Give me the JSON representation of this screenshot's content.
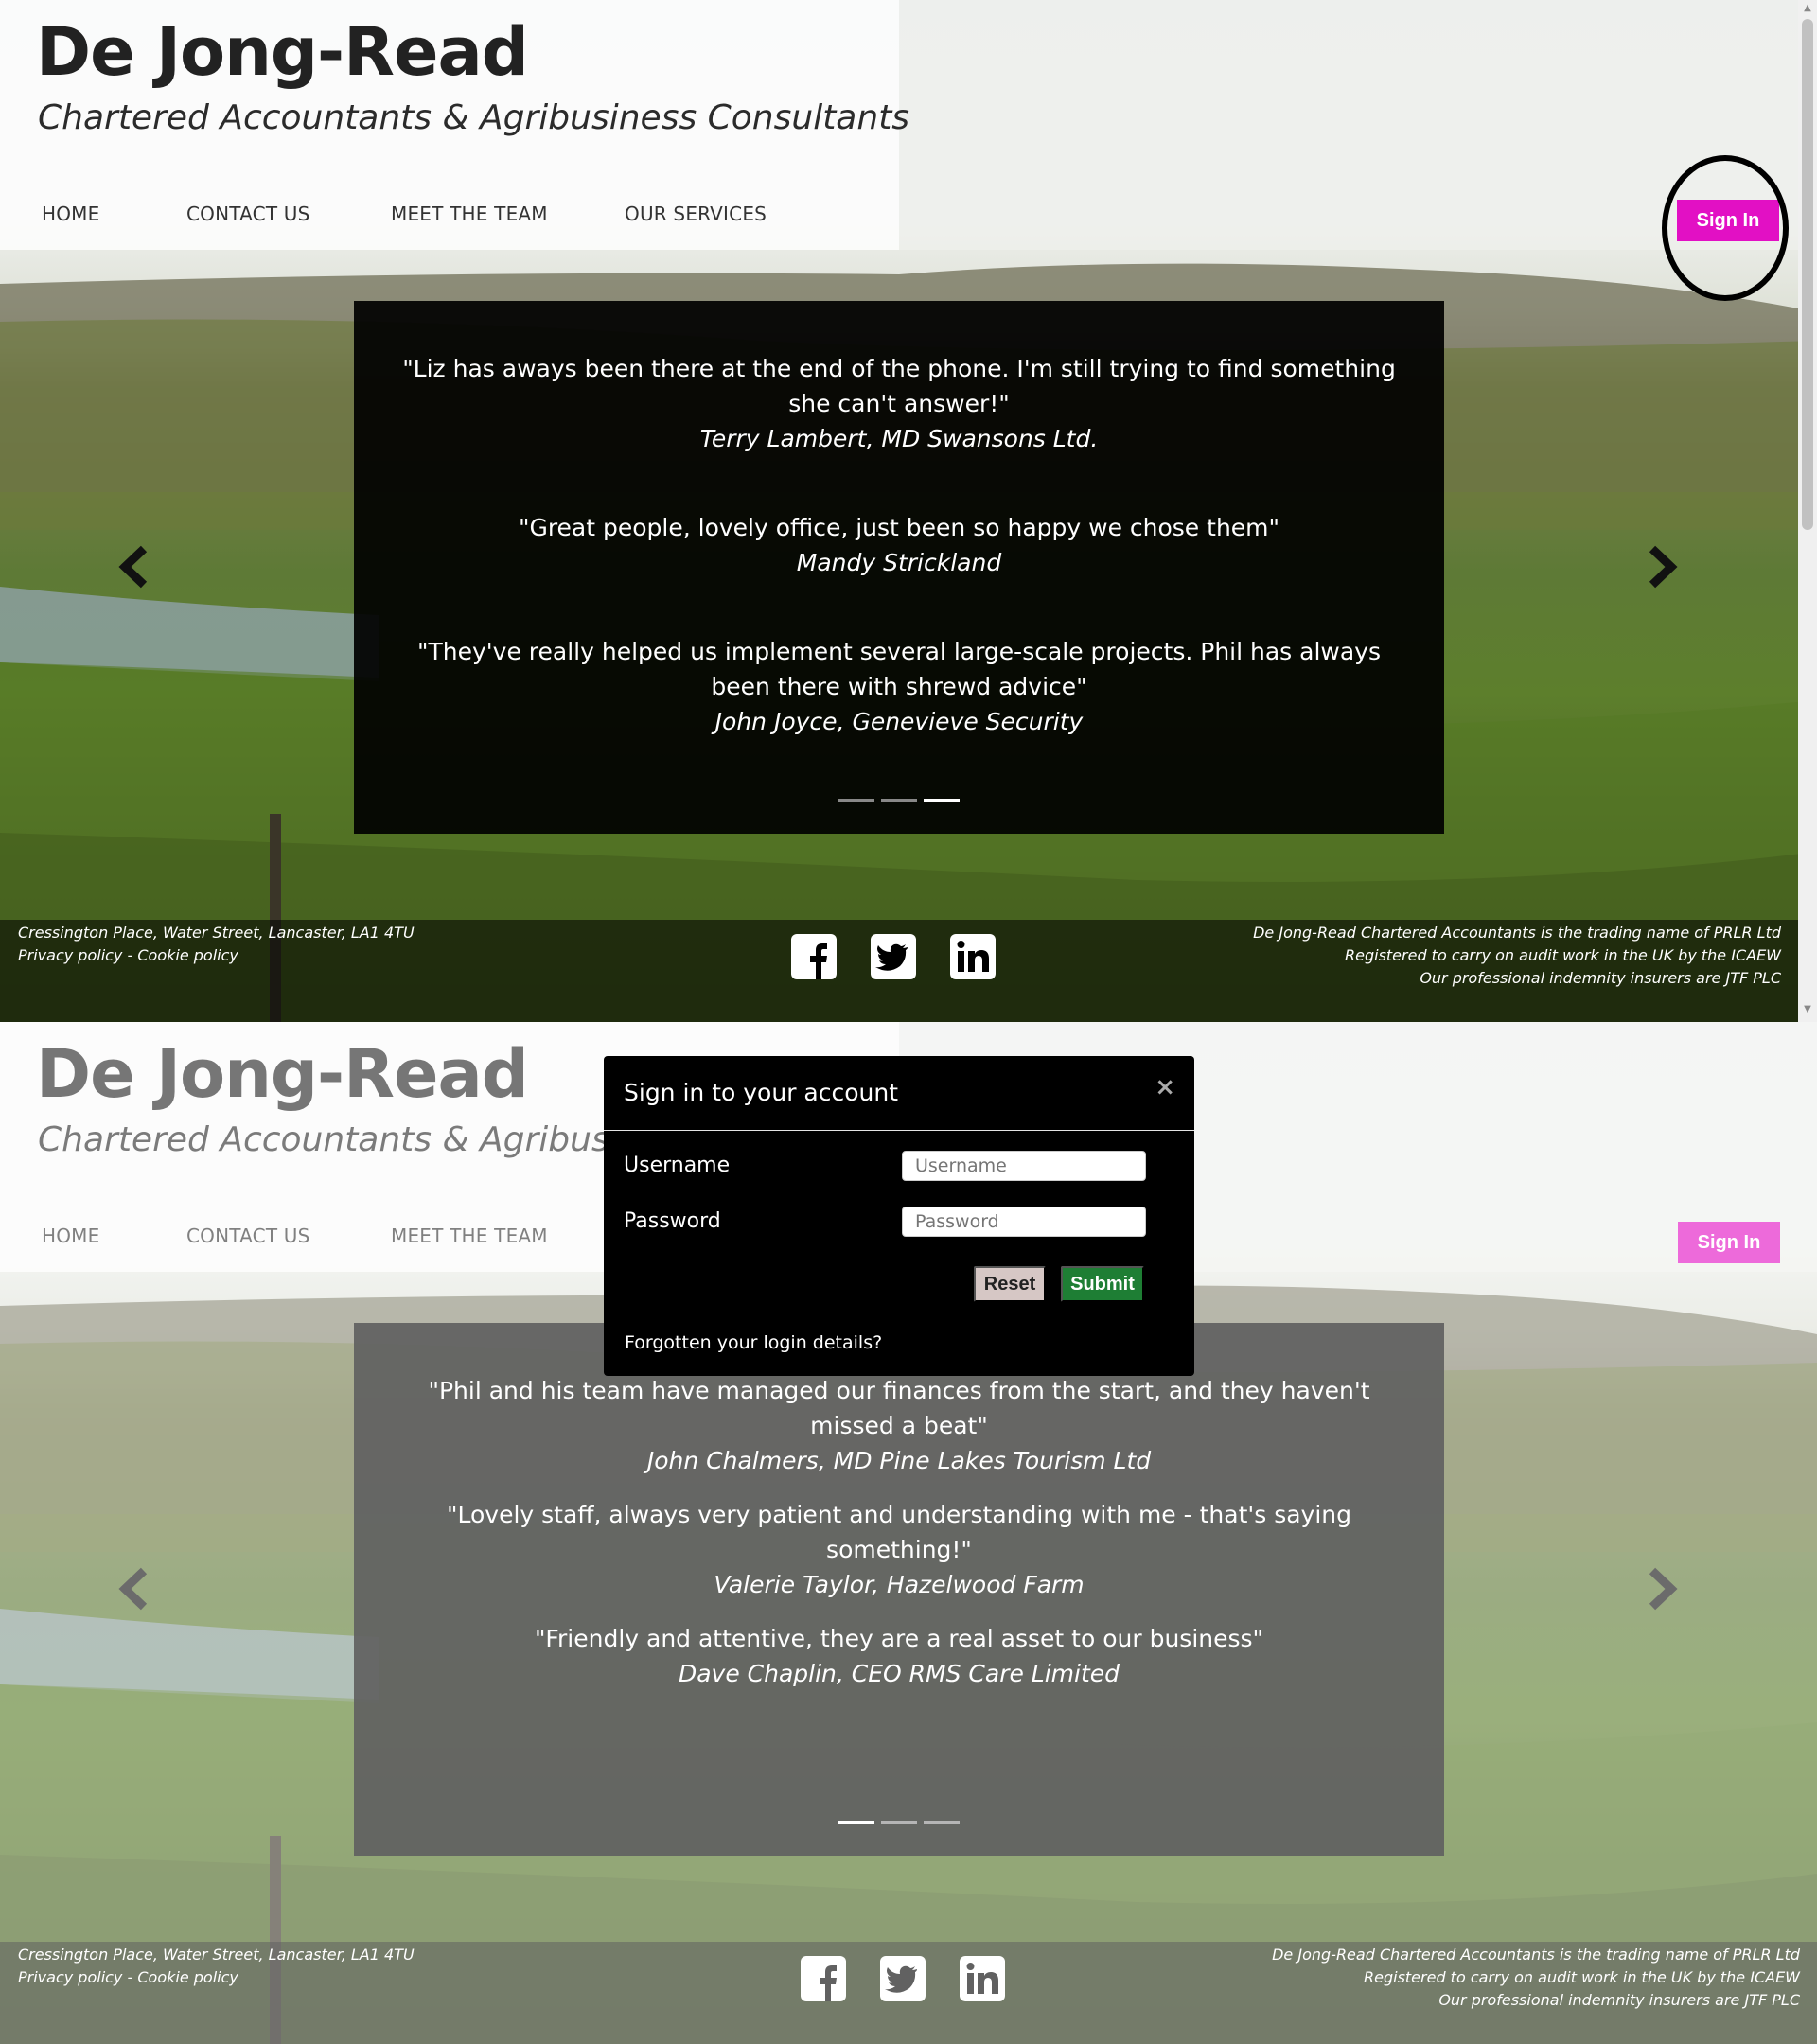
{
  "brand": {
    "title": "De Jong-Read",
    "subtitle": "Chartered Accountants & Agribusiness Consultants"
  },
  "nav": {
    "items": [
      {
        "label": "HOME"
      },
      {
        "label": "CONTACT US"
      },
      {
        "label": "MEET THE TEAM"
      },
      {
        "label": "OUR SERVICES"
      }
    ]
  },
  "signin": {
    "label": "Sign In"
  },
  "carousel_top": {
    "testimonials": [
      {
        "quote": "\"Liz has aways been there at the end of the phone. I'm still trying to find something she can't answer!\"",
        "author": "Terry Lambert, MD Swansons Ltd."
      },
      {
        "quote": "\"Great people, lovely office, just been so happy we chose them\"",
        "author": "Mandy Strickland"
      },
      {
        "quote": "\"They've really helped us implement several large-scale projects. Phil has always been there with shrewd advice\"",
        "author": "John Joyce, Genevieve Security"
      }
    ],
    "active_indicator": 3
  },
  "carousel_bottom": {
    "testimonials": [
      {
        "quote": "\"Phil and his team have managed our finances from the start, and they haven't missed a beat\"",
        "author": "John Chalmers, MD Pine Lakes Tourism Ltd"
      },
      {
        "quote": "\"Lovely staff, always very patient and understanding with me - that's saying something!\"",
        "author": "Valerie Taylor, Hazelwood Farm"
      },
      {
        "quote": "\"Friendly and attentive, they are a real asset to our business\"",
        "author": "Dave Chaplin, CEO RMS Care Limited"
      }
    ],
    "active_indicator": 1
  },
  "footer": {
    "address": "Cressington Place, Water Street, Lancaster, LA1 4TU",
    "privacy": "Privacy policy",
    "separator": " - ",
    "cookie": "Cookie policy",
    "legal_1": "De Jong-Read Chartered Accountants is the trading name of PRLR Ltd",
    "legal_2": "Registered to carry on audit work in the UK by the ICAEW",
    "legal_3": "Our professional indemnity insurers are JTF PLC"
  },
  "modal": {
    "title": "Sign in to your account",
    "close": "×",
    "username_label": "Username",
    "username_placeholder": "Username",
    "password_label": "Password",
    "password_placeholder": "Password",
    "reset": "Reset",
    "submit": "Submit",
    "forgot": "Forgotten your login details?"
  },
  "colors": {
    "signin": "#e210c4",
    "submit": "#1e7e34",
    "reset": "#d6c7c5"
  }
}
